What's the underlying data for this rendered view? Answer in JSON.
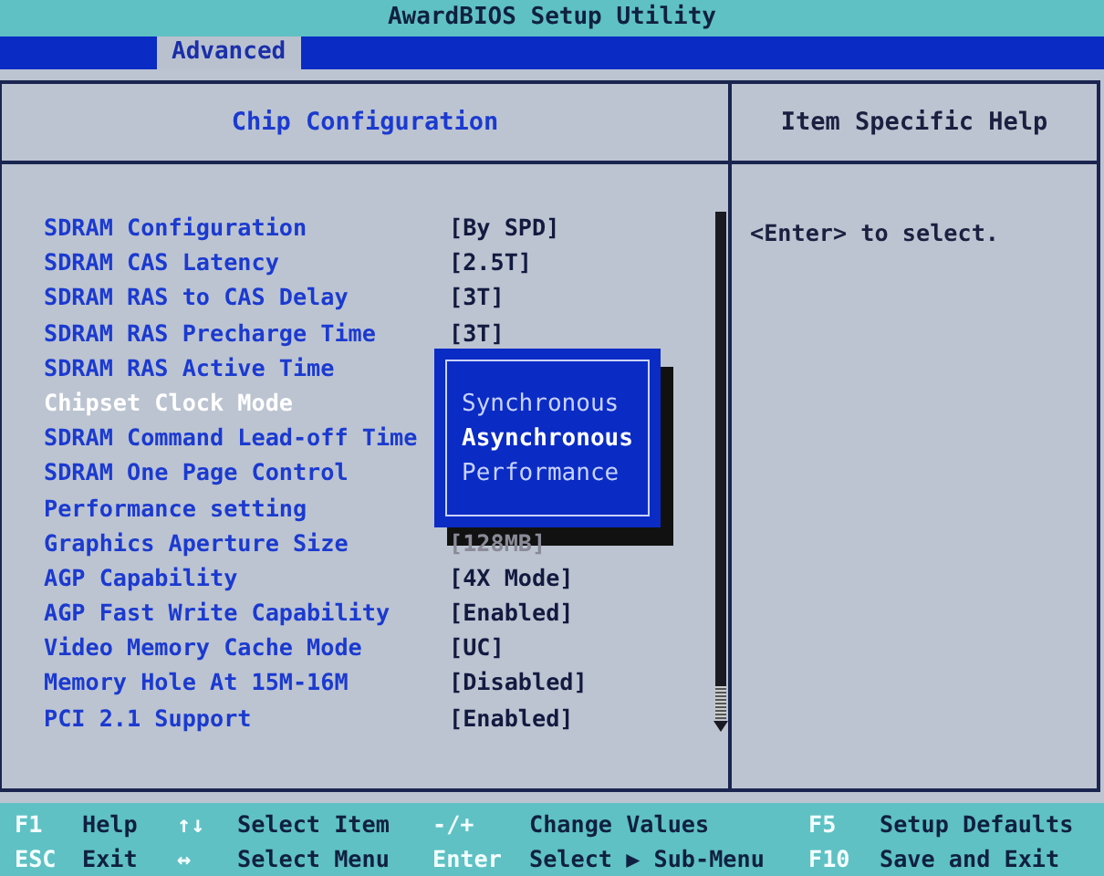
{
  "window": {
    "title": "AwardBIOS Setup Utility"
  },
  "tabs": [
    {
      "label": "Advanced",
      "selected": true
    }
  ],
  "panel": {
    "title": "Chip Configuration",
    "help_title": "Item Specific Help",
    "help_text": "<Enter> to select."
  },
  "items": [
    {
      "label": "SDRAM Configuration",
      "value": "[By SPD]",
      "selected": false
    },
    {
      "label": "SDRAM CAS Latency",
      "value": "[2.5T]",
      "selected": false
    },
    {
      "label": "SDRAM RAS to CAS Delay",
      "value": "[3T]",
      "selected": false
    },
    {
      "label": "SDRAM RAS Precharge Time",
      "value": "[3T]",
      "selected": false
    },
    {
      "label": "SDRAM RAS Active Time",
      "selected": false
    },
    {
      "label": "Chipset Clock Mode",
      "selected": true
    },
    {
      "label": "SDRAM Command Lead-off Time",
      "selected": false
    },
    {
      "label": "SDRAM One Page Control",
      "selected": false
    },
    {
      "label": "Performance setting",
      "selected": false
    },
    {
      "label": "Graphics Aperture Size",
      "value": "[128MB]",
      "shaded": true,
      "selected": false
    },
    {
      "label": "AGP Capability",
      "value": "[4X Mode]",
      "selected": false
    },
    {
      "label": "AGP Fast Write Capability",
      "value": "[Enabled]",
      "selected": false
    },
    {
      "label": "Video Memory Cache Mode",
      "value": "[UC]",
      "selected": false
    },
    {
      "label": "Memory Hole At 15M-16M",
      "value": "[Disabled]",
      "selected": false
    },
    {
      "label": "PCI 2.1 Support",
      "value": "[Enabled]",
      "selected": false
    }
  ],
  "popup": {
    "options": [
      {
        "label": "Synchronous",
        "selected": false
      },
      {
        "label": "Asynchronous",
        "selected": true
      },
      {
        "label": "Performance",
        "selected": false
      }
    ]
  },
  "footer": [
    [
      {
        "key": "F1",
        "desc": "Help"
      },
      {
        "key": "↑↓",
        "desc": "Select Item"
      },
      {
        "key": "-/+",
        "desc": "Change Values"
      },
      {
        "key": "F5",
        "desc": "Setup Defaults"
      }
    ],
    [
      {
        "key": "ESC",
        "desc": "Exit"
      },
      {
        "key": "↔",
        "desc": "Select Menu"
      },
      {
        "key": "Enter",
        "desc": "Select ▶ Sub-Menu"
      },
      {
        "key": "F10",
        "desc": "Save and Exit"
      }
    ]
  ]
}
